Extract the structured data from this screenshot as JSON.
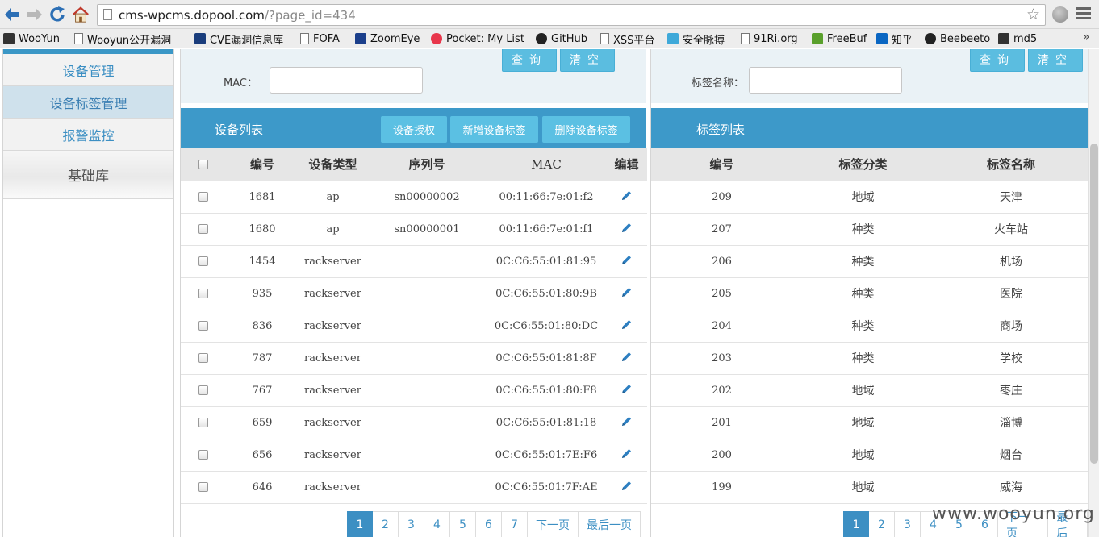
{
  "browser": {
    "url_host": "cms-wpcms.dopool.com",
    "url_path": "/?page_id=434",
    "bookmarks": [
      {
        "label": "WooYun",
        "icon": "wooyun-icon"
      },
      {
        "label": "Wooyun公开漏洞",
        "icon": "page-icon"
      },
      {
        "label": "CVE漏洞信息库",
        "icon": "cve-icon"
      },
      {
        "label": "FOFA",
        "icon": "page-icon"
      },
      {
        "label": "ZoomEye",
        "icon": "zoomeye-icon"
      },
      {
        "label": "Pocket: My List",
        "icon": "pocket-icon"
      },
      {
        "label": "GitHub",
        "icon": "github-icon"
      },
      {
        "label": "XSS平台",
        "icon": "page-icon"
      },
      {
        "label": "安全脉搏",
        "icon": "cloud-icon"
      },
      {
        "label": "91Ri.org",
        "icon": "page-icon"
      },
      {
        "label": "FreeBuf",
        "icon": "freebuf-icon"
      },
      {
        "label": "知乎",
        "icon": "zhihu-icon"
      },
      {
        "label": "Beebeeto",
        "icon": "beebeeto-icon"
      },
      {
        "label": "md5",
        "icon": "grid-icon"
      }
    ],
    "more": "»"
  },
  "sidebar": {
    "items": [
      {
        "label": "设备管理",
        "active": false
      },
      {
        "label": "设备标签管理",
        "active": true
      },
      {
        "label": "报警监控",
        "active": false
      }
    ],
    "section": "基础库"
  },
  "device_panel": {
    "search_label": "MAC：",
    "search_value": "",
    "query_button": "查询",
    "clear_button": "清空",
    "title": "设备列表",
    "buttons": [
      "设备授权",
      "新增设备标签",
      "删除设备标签"
    ],
    "columns": [
      "编号",
      "设备类型",
      "序列号",
      "MAC",
      "编辑"
    ],
    "rows": [
      {
        "id": "1681",
        "type": "ap",
        "serial": "sn00000002",
        "mac": "00:11:66:7e:01:f2"
      },
      {
        "id": "1680",
        "type": "ap",
        "serial": "sn00000001",
        "mac": "00:11:66:7e:01:f1"
      },
      {
        "id": "1454",
        "type": "rackserver",
        "serial": "",
        "mac": "0C:C6:55:01:81:95"
      },
      {
        "id": "935",
        "type": "rackserver",
        "serial": "",
        "mac": "0C:C6:55:01:80:9B"
      },
      {
        "id": "836",
        "type": "rackserver",
        "serial": "",
        "mac": "0C:C6:55:01:80:DC"
      },
      {
        "id": "787",
        "type": "rackserver",
        "serial": "",
        "mac": "0C:C6:55:01:81:8F"
      },
      {
        "id": "767",
        "type": "rackserver",
        "serial": "",
        "mac": "0C:C6:55:01:80:F8"
      },
      {
        "id": "659",
        "type": "rackserver",
        "serial": "",
        "mac": "0C:C6:55:01:81:18"
      },
      {
        "id": "656",
        "type": "rackserver",
        "serial": "",
        "mac": "0C:C6:55:01:7E:F6"
      },
      {
        "id": "646",
        "type": "rackserver",
        "serial": "",
        "mac": "0C:C6:55:01:7F:AE"
      }
    ],
    "pages": [
      "1",
      "2",
      "3",
      "4",
      "5",
      "6",
      "7",
      "下一页",
      "最后一页"
    ],
    "current_page": "1"
  },
  "tag_panel": {
    "search_label": "标签名称：",
    "search_value": "",
    "query_button": "查询",
    "clear_button": "清空",
    "title": "标签列表",
    "columns": [
      "编号",
      "标签分类",
      "标签名称"
    ],
    "rows": [
      {
        "id": "209",
        "category": "地域",
        "name": "天津"
      },
      {
        "id": "207",
        "category": "种类",
        "name": "火车站"
      },
      {
        "id": "206",
        "category": "种类",
        "name": "机场"
      },
      {
        "id": "205",
        "category": "种类",
        "name": "医院"
      },
      {
        "id": "204",
        "category": "种类",
        "name": "商场"
      },
      {
        "id": "203",
        "category": "种类",
        "name": "学校"
      },
      {
        "id": "202",
        "category": "地域",
        "name": "枣庄"
      },
      {
        "id": "201",
        "category": "地域",
        "name": "淄博"
      },
      {
        "id": "200",
        "category": "地域",
        "name": "烟台"
      },
      {
        "id": "199",
        "category": "地域",
        "name": "威海"
      }
    ],
    "pages": [
      "1",
      "2",
      "3",
      "4",
      "5",
      "6",
      "下一页",
      "最后"
    ],
    "current_page": "1"
  },
  "watermark": "www.wooyun.org",
  "colors": {
    "accent": "#3d99c9",
    "button": "#5bbde0",
    "link": "#3c8fc3"
  }
}
